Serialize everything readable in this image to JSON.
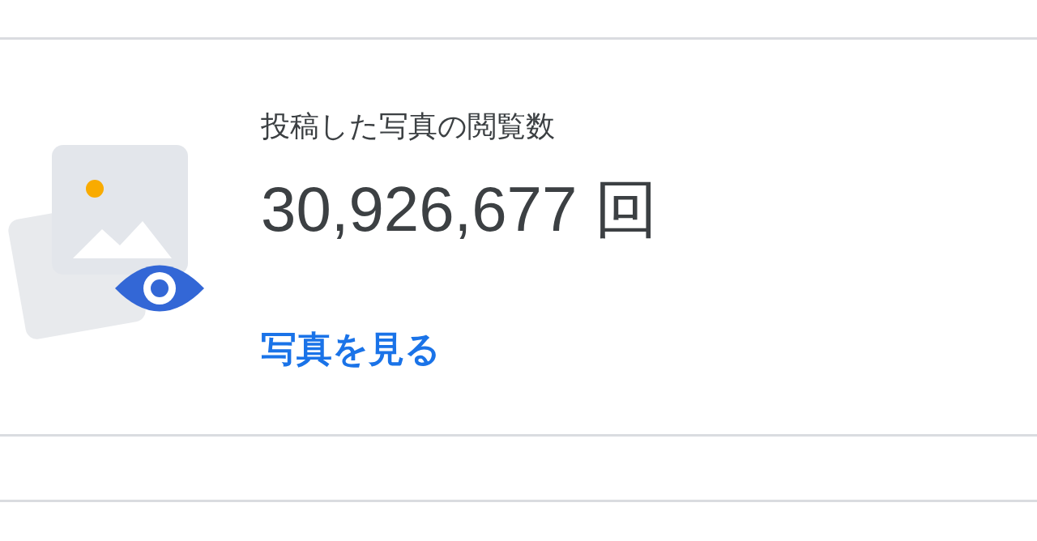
{
  "stat_card": {
    "title": "投稿した写真の閲覧数",
    "value": "30,926,677 回",
    "link": "写真を見る"
  }
}
